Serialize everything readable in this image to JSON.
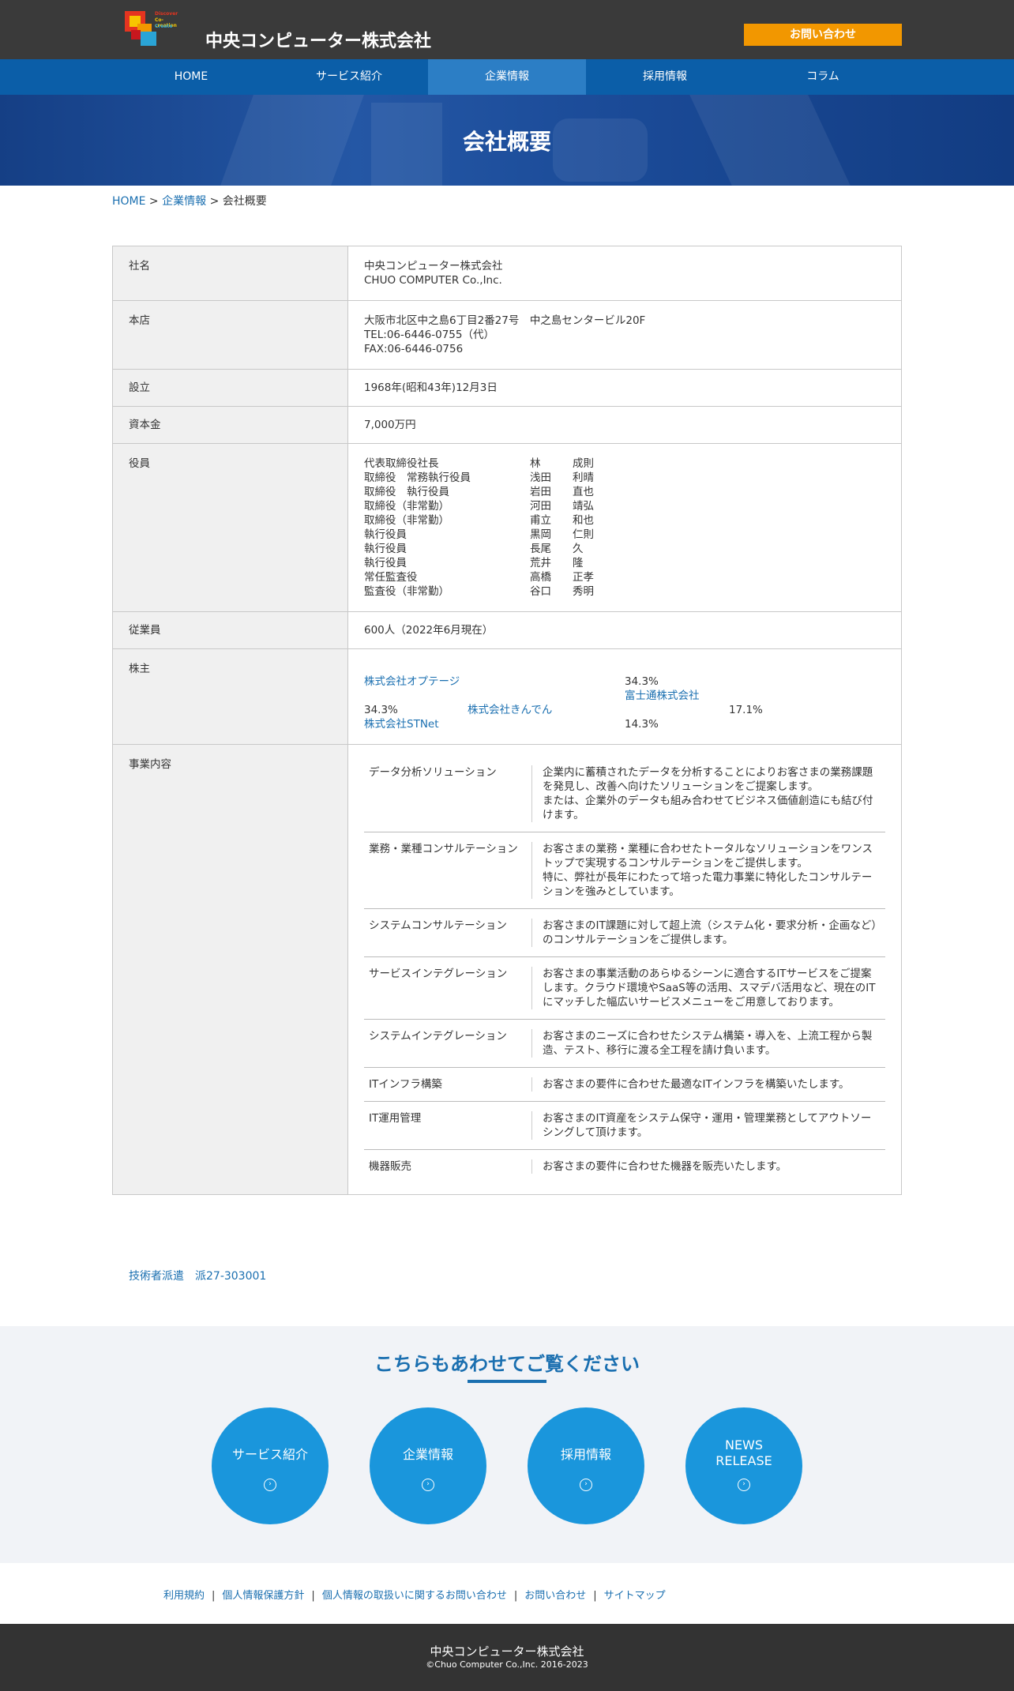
{
  "header": {
    "logo_text": [
      "Discover",
      "Co-creation",
      "Create"
    ],
    "company_name": "中央コンピューター株式会社",
    "contact_button": "お問い合わせ"
  },
  "nav": {
    "items": [
      {
        "label": "HOME"
      },
      {
        "label": "サービス紹介"
      },
      {
        "label": "企業情報"
      },
      {
        "label": "採用情報"
      },
      {
        "label": "コラム"
      }
    ],
    "active": "企業情報"
  },
  "hero": {
    "title": "会社概要"
  },
  "breadcrumb": {
    "home": "HOME",
    "sep": " > ",
    "parent": "企業情報",
    "current": "会社概要"
  },
  "info": {
    "company": {
      "label": "社名",
      "name_ja": "中央コンピューター株式会社",
      "name_en": "CHUO COMPUTER Co.,Inc."
    },
    "hq": {
      "label": "本店",
      "address": "大阪市北区中之島6丁目2番27号　中之島センタービル20F",
      "tel": "TEL:06-6446-0755（代）",
      "fax": "FAX:06-6446-0756"
    },
    "founded": {
      "label": "設立",
      "value": "1968年(昭和43年)12月3日"
    },
    "capital": {
      "label": "資本金",
      "value": "7,000万円"
    },
    "officers": {
      "label": "役員",
      "rows": [
        {
          "title": "代表取締役社長",
          "family": "林",
          "given": "成則"
        },
        {
          "title": "取締役　常務執行役員",
          "family": "浅田",
          "given": "利晴"
        },
        {
          "title": "取締役　執行役員",
          "family": "岩田",
          "given": "直也"
        },
        {
          "title": "取締役（非常勤）",
          "family": "河田",
          "given": "靖弘"
        },
        {
          "title": "取締役（非常勤）",
          "family": "甫立",
          "given": "和也"
        },
        {
          "title": "執行役員",
          "family": "黒岡",
          "given": "仁則"
        },
        {
          "title": "執行役員",
          "family": "長尾",
          "given": "久"
        },
        {
          "title": "執行役員",
          "family": "荒井",
          "given": "隆"
        },
        {
          "title": "常任監査役",
          "family": "高橋",
          "given": "正孝"
        },
        {
          "title": "監査役（非常勤）",
          "family": "谷口",
          "given": "秀明"
        }
      ]
    },
    "employees": {
      "label": "従業員",
      "value": "600人（2022年6月現在）"
    },
    "shareholders": {
      "label": "株主",
      "items": [
        {
          "name": "株式会社オプテージ",
          "pct": "34.3%"
        },
        {
          "name": "富士通株式会社",
          "pct": "34.3%"
        },
        {
          "name": "株式会社きんでん",
          "pct": "17.1%"
        },
        {
          "name": "株式会社STNet",
          "pct": "14.3%"
        }
      ]
    },
    "business": {
      "label": "事業内容",
      "rows": [
        {
          "name": "データ分析ソリューション",
          "desc": "企業内に蓄積されたデータを分析することによりお客さまの業務課題を発見し、改善へ向けたソリューションをご提案します。\nまたは、企業外のデータも組み合わせてビジネス価値創造にも結び付けます。"
        },
        {
          "name": "業務・業種コンサルテーション",
          "desc": "お客さまの業務・業種に合わせたトータルなソリューションをワンストップで実現するコンサルテーションをご提供します。\n特に、弊社が長年にわたって培った電力事業に特化したコンサルテーションを強みとしています。"
        },
        {
          "name": "システムコンサルテーション",
          "desc": "お客さまのIT課題に対して超上流（システム化・要求分析・企画など）のコンサルテーションをご提供します。"
        },
        {
          "name": "サービスインテグレーション",
          "desc": "お客さまの事業活動のあらゆるシーンに適合するITサービスをご提案します。クラウド環境やSaaS等の活用、スマデバ活用など、現在のITにマッチした幅広いサービスメニューをご用意しております。"
        },
        {
          "name": "システムインテグレーション",
          "desc": "お客さまのニーズに合わせたシステム構築・導入を、上流工程から製造、テスト、移行に渡る全工程を請け負います。"
        },
        {
          "name": "ITインフラ構築",
          "desc": "お客さまの要件に合わせた最適なITインフラを構築いたします。"
        },
        {
          "name": "IT運用管理",
          "desc": "お客さまのIT資産をシステム保守・運用・管理業務としてアウトソーシングして頂けます。"
        },
        {
          "name": "機器販売",
          "desc": "お客さまの要件に合わせた機器を販売いたします。"
        }
      ]
    }
  },
  "dispatch": "技術者派遣　派27-303001",
  "related": {
    "heading": "こちらもあわせてご覧ください",
    "circles": [
      {
        "label": "サービス紹介"
      },
      {
        "label": "企業情報"
      },
      {
        "label": "採用情報"
      },
      {
        "line1": "NEWS",
        "line2": "RELEASE"
      }
    ],
    "arrow_icon": "chevron-circle-right-icon"
  },
  "footer_links": [
    "利用規約",
    "個人情報保護方針",
    "個人情報の取扱いに関するお問い合わせ",
    "お問い合わせ",
    "サイトマップ"
  ],
  "footer_sep": "|",
  "footer": {
    "company": "中央コンピューター株式会社",
    "copyright": "©Chuo Computer Co.,Inc. 2016-2023"
  },
  "colors": {
    "header_bg": "#3a3a3a",
    "nav_bg": "#0b5ea8",
    "nav_active": "#2c7ec5",
    "accent_orange": "#f29700",
    "link_blue": "#1a6fb0",
    "circle_blue": "#1a96dc"
  }
}
